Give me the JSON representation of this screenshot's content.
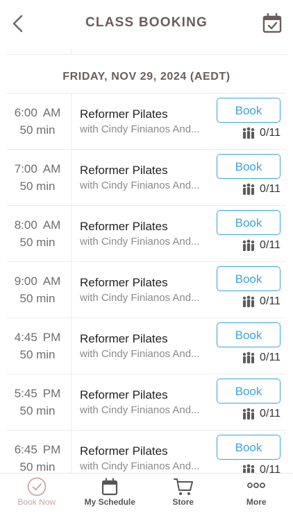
{
  "header": {
    "title": "CLASS BOOKING"
  },
  "date_header": "FRIDAY, NOV 29, 2024 (AEDT)",
  "classes": [
    {
      "time": "6:00",
      "ampm": "AM",
      "duration": "50 min",
      "name": "Reformer Pilates",
      "instructor": "with Cindy Finianos And...",
      "book_label": "Book",
      "capacity": "0/11"
    },
    {
      "time": "7:00",
      "ampm": "AM",
      "duration": "50 min",
      "name": "Reformer Pilates",
      "instructor": "with Cindy Finianos And...",
      "book_label": "Book",
      "capacity": "0/11"
    },
    {
      "time": "8:00",
      "ampm": "AM",
      "duration": "50 min",
      "name": "Reformer Pilates",
      "instructor": "with Cindy Finianos And...",
      "book_label": "Book",
      "capacity": "0/11"
    },
    {
      "time": "9:00",
      "ampm": "AM",
      "duration": "50 min",
      "name": "Reformer Pilates",
      "instructor": "with Cindy Finianos And...",
      "book_label": "Book",
      "capacity": "0/11"
    },
    {
      "time": "4:45",
      "ampm": "PM",
      "duration": "50 min",
      "name": "Reformer Pilates",
      "instructor": "with Cindy Finianos And...",
      "book_label": "Book",
      "capacity": "0/11"
    },
    {
      "time": "5:45",
      "ampm": "PM",
      "duration": "50 min",
      "name": "Reformer Pilates",
      "instructor": "with Cindy Finianos And...",
      "book_label": "Book",
      "capacity": "0/11"
    },
    {
      "time": "6:45",
      "ampm": "PM",
      "duration": "50 min",
      "name": "Reformer Pilates",
      "instructor": "with Cindy Finianos And...",
      "book_label": "Book",
      "capacity": "0/11"
    }
  ],
  "tabbar": {
    "items": [
      {
        "label": "Book Now",
        "icon": "check-circle-icon",
        "active": true
      },
      {
        "label": "My Schedule",
        "icon": "calendar-icon",
        "active": false
      },
      {
        "label": "Store",
        "icon": "cart-icon",
        "active": false
      },
      {
        "label": "More",
        "icon": "more-dots-icon",
        "active": false
      }
    ]
  },
  "colors": {
    "accent": "#3aa3dc",
    "active_tab": "#caa6a6",
    "title": "#6b5d5d"
  }
}
